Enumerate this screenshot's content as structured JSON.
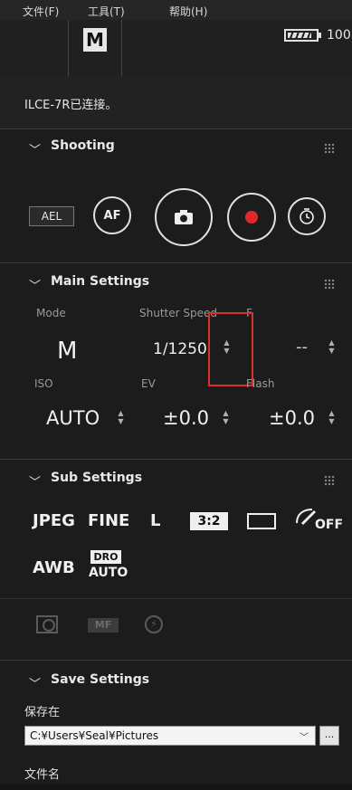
{
  "menu": [
    "文件(F)",
    "工具(T)",
    "帮助(H)"
  ],
  "top": {
    "mode_badge": "M",
    "battery_pct": "100",
    "battery_level": 0.85
  },
  "connection_status": "ILCE-7R已连接。",
  "shooting": {
    "title": "Shooting",
    "ael": "AEL",
    "af": "AF",
    "camera_icon": "camera-icon",
    "record_icon": "record-icon",
    "timer_icon": "self-timer-icon"
  },
  "main_settings": {
    "title": "Main Settings",
    "labels": {
      "mode": "Mode",
      "shutter": "Shutter Speed",
      "fnum": "F",
      "iso": "ISO",
      "ev": "EV",
      "flash": "Flash"
    },
    "values": {
      "mode": "M",
      "shutter": "1/1250",
      "fnum": "--",
      "iso": "AUTO",
      "ev": "±0.0",
      "flash": "±0.0"
    }
  },
  "sub_settings": {
    "title": "Sub Settings",
    "format": "JPEG",
    "quality": "FINE",
    "size": "L",
    "aspect": "3:2",
    "wb": "AWB",
    "dro_top": "DRO",
    "dro_bottom": "AUTO",
    "mf_label": "MF",
    "flash_off": "OFF"
  },
  "save_settings": {
    "title": "Save Settings",
    "save_in_label": "保存在",
    "path": "C:¥Users¥Seal¥Pictures",
    "browse_label": "...",
    "filename_label": "文件名"
  },
  "colors": {
    "background": "#1c1c1c",
    "highlight_box": "#d9312b",
    "record_dot": "#e0282a"
  }
}
